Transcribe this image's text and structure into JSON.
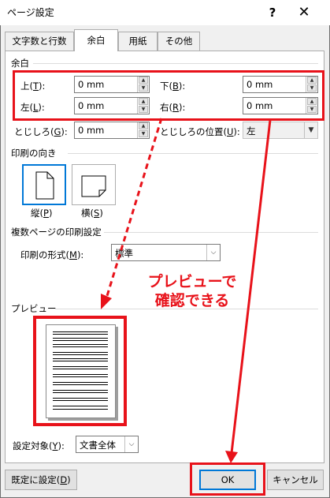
{
  "window": {
    "title": "ページ設定",
    "help_glyph": "?",
    "close_glyph": "✕"
  },
  "tabs": [
    {
      "label": "文字数と行数",
      "active": false
    },
    {
      "label": "余白",
      "active": true
    },
    {
      "label": "用紙",
      "active": false
    },
    {
      "label": "その他",
      "active": false
    }
  ],
  "margins": {
    "section_label": "余白",
    "top": {
      "label": "上(",
      "key": "T",
      "suffix": "):",
      "value": "0 mm"
    },
    "bottom": {
      "label": "下(",
      "key": "B",
      "suffix": "):",
      "value": "0 mm"
    },
    "left": {
      "label": "左(",
      "key": "L",
      "suffix": "):",
      "value": "0 mm"
    },
    "right": {
      "label": "右(",
      "key": "R",
      "suffix": "):",
      "value": "0 mm"
    },
    "gutter": {
      "label": "とじしろ(",
      "key": "G",
      "suffix": "):",
      "value": "0 mm"
    },
    "gutter_pos": {
      "label": "とじしろの位置(",
      "key": "U",
      "suffix": "):",
      "value": "左"
    }
  },
  "orientation": {
    "section_label": "印刷の向き",
    "portrait": {
      "label": "縦(",
      "key": "P",
      "suffix": ")",
      "selected": true
    },
    "landscape": {
      "label": "横(",
      "key": "S",
      "suffix": ")",
      "selected": false
    }
  },
  "pages": {
    "section_label": "複数ページの印刷設定",
    "format": {
      "label": "印刷の形式(",
      "key": "M",
      "suffix": "):",
      "value": "標準"
    }
  },
  "preview": {
    "section_label": "プレビュー"
  },
  "apply_to": {
    "label": "設定対象(",
    "key": "Y",
    "suffix": "):",
    "value": "文書全体"
  },
  "buttons": {
    "default": {
      "label": "既定に設定(",
      "key": "D",
      "suffix": ")"
    },
    "ok": "OK",
    "cancel": "キャンセル"
  },
  "annotation": {
    "line1": "プレビューで",
    "line2": "確認できる",
    "color": "#e8121a"
  },
  "colors": {
    "accent": "#0078d7",
    "highlight": "#e8121a"
  }
}
